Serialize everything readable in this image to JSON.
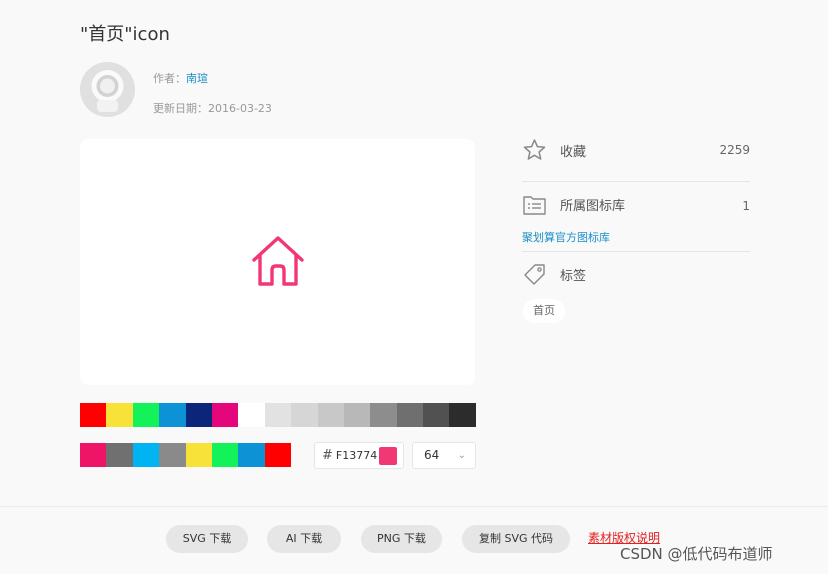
{
  "title": "\"首页\"icon",
  "author": {
    "label": "作者：",
    "name": "南瑄"
  },
  "update": {
    "label": "更新日期：",
    "date": "2016-03-23"
  },
  "icon": {
    "name": "home-icon",
    "color": "#F13774"
  },
  "swatches_row1": [
    "#ff0000",
    "#f7e23a",
    "#14f25a",
    "#0e92d6",
    "#0a2579",
    "#e4077c",
    "#ffffff",
    "#e2e2e2",
    "#d6d6d6",
    "#c8c8c8",
    "#b8b8b8",
    "#8d8d8d",
    "#6f6f6f",
    "#515151",
    "#2c2c2c"
  ],
  "swatches_row2": [
    "#ee1566",
    "#707070",
    "#00b4f2",
    "#8a8a8a",
    "#f7e23a",
    "#14f25a",
    "#0e92d6",
    "#ff0000"
  ],
  "color_input": {
    "hash": "#",
    "value": "F13774",
    "color": "#F13774"
  },
  "size_select": {
    "value": "64"
  },
  "sidebar": {
    "favorite": {
      "label": "收藏",
      "count": "2259",
      "icon": "star-icon"
    },
    "library": {
      "label": "所属图标库",
      "count": "1",
      "icon": "folder-list-icon",
      "link": "聚划算官方图标库"
    },
    "tags": {
      "label": "标签",
      "icon": "tag-icon",
      "items": [
        "首页"
      ]
    }
  },
  "actions": {
    "svg_download": "SVG 下载",
    "ai_download": "AI 下载",
    "png_download": "PNG 下载",
    "copy_svg": "复制 SVG 代码",
    "license": "素材版权说明"
  },
  "watermark": "CSDN @低代码布道师"
}
